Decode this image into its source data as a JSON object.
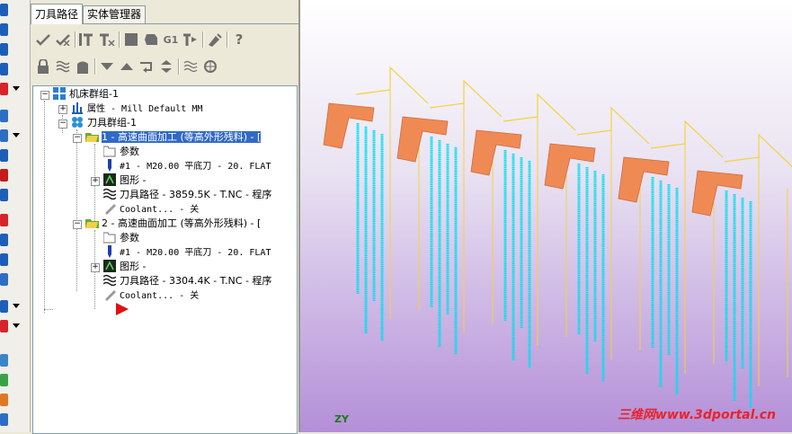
{
  "tabs": [
    "刀具路径",
    "实体管理器"
  ],
  "toolbar1_icons": [
    "select-all-ops-icon",
    "select-all-failed-icon",
    "regenerate-selected-icon",
    "regenerate-dirty-icon",
    "backplot-icon",
    "verify-icon",
    "post-g1-icon",
    "high-feed-icon",
    "delete-all-icon",
    "help-icon"
  ],
  "toolbar1_text": {
    "g1": "G1"
  },
  "toolbar2_icons": [
    "lock-icon",
    "toggle-display-icon",
    "toggle-post-icon",
    "move-down-icon",
    "move-up-icon",
    "insert-arrow-icon",
    "scroll-icon",
    "display-paths-icon",
    "display-pattern-icon"
  ],
  "tree": {
    "machine_group": "机床群组-1",
    "properties": "属性 - Mill Default MM",
    "toolpath_group": "刀具群组-1",
    "op1": {
      "title": "1 - 高速曲面加工 (等高外形残料) - [",
      "params": "参数",
      "tool": "#1 - M20.00 平底刀 -    20. FLAT",
      "geometry": "图形 -",
      "toolpath": "刀具路径 - 3859.5K - T.NC - 程序",
      "coolant": "Coolant... - 关"
    },
    "op2": {
      "title": "2 - 高速曲面加工 (等高外形残料) - [",
      "params": "参数",
      "tool": "#1 - M20.00 平底刀 -    20. FLAT",
      "geometry": "图形 -",
      "toolpath": "刀具路径 - 3304.4K - T.NC - 程序",
      "coolant": "Coolant... - 关"
    }
  },
  "viewport": {
    "axis_label": "ZY",
    "watermark": "三维网www.3dportal.cn"
  },
  "colors": {
    "toolpath_cyan": "#00e0f0",
    "toolpath_yellow": "#f5d23a",
    "part_orange": "#f08a55",
    "selection": "#316ac5"
  }
}
